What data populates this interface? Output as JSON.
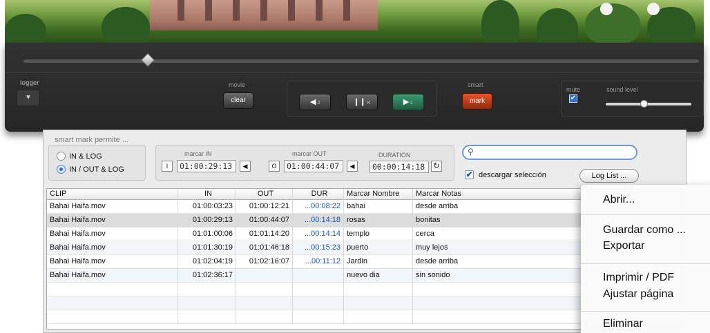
{
  "panel": {
    "logger_label": "logger",
    "logger_icon": "triangle-down-icon",
    "movie_label": "movie",
    "clear_label": "clear",
    "smart_label": "smart",
    "mark_label": "mark",
    "mute_label": "mute",
    "mute_checked": true,
    "sound_label": "sound level",
    "transport": [
      {
        "name": "rewind",
        "icon": "play-left-icon",
        "glyph": "◀",
        "key": "J"
      },
      {
        "name": "pause",
        "icon": "pause-icon",
        "glyph": "❙❙",
        "key": "K"
      },
      {
        "name": "play",
        "icon": "play-right-icon",
        "glyph": "▶",
        "key": "L"
      }
    ]
  },
  "logger": {
    "title": "smart mark permite ...",
    "radio": [
      {
        "label": "IN & LOG",
        "selected": false
      },
      {
        "label": "IN / OUT & LOG",
        "selected": true
      }
    ],
    "marcar_in_label": "marcar  IN",
    "in_key": "I",
    "in_value": "01:00:29:13",
    "marcar_out_label": "marcar OUT",
    "out_key": "O",
    "out_value": "01:00:44:07",
    "duration_label": "DURATION",
    "duration_value": "00:00:14:18",
    "search_placeholder": "",
    "descargar_label": "descargar selección",
    "descargar_checked": true,
    "loglist_label": "Log List ..."
  },
  "table": {
    "headers": [
      "CLIP",
      "IN",
      "OUT",
      "DUR",
      "Marcar Nombre",
      "Marcar Notas"
    ],
    "rows": [
      [
        "Bahai Haifa.mov",
        "01:00:03:23",
        "01:00:12:21",
        "...00:08:22",
        "bahai",
        "desde arriba"
      ],
      [
        "Bahai Haifa.mov",
        "01:00:29:13",
        "01:00:44:07",
        "...00:14:18",
        "rosas",
        "bonitas"
      ],
      [
        "Bahai Haifa.mov",
        "01:01:00:06",
        "01:01:14:20",
        "...00:14:14",
        "templo",
        "cerca"
      ],
      [
        "Bahai Haifa.mov",
        "01:01:30:19",
        "01:01:46:18",
        "...00:15:23",
        "puerto",
        "muy lejos"
      ],
      [
        "Bahai Haifa.mov",
        "01:02:04:19",
        "01:02:16:07",
        "...00:11:12",
        "Jardin",
        "desde arriba"
      ],
      [
        "Bahai Haifa.mov",
        "01:02:36:17",
        "",
        "",
        "nuevo dia",
        "sin sonido"
      ]
    ],
    "selected_row": 1
  },
  "menu": {
    "items": [
      "Abrir...",
      "Guardar como ...",
      "Exportar",
      "Imprimir / PDF",
      "Ajustar página",
      "Eliminar"
    ]
  }
}
